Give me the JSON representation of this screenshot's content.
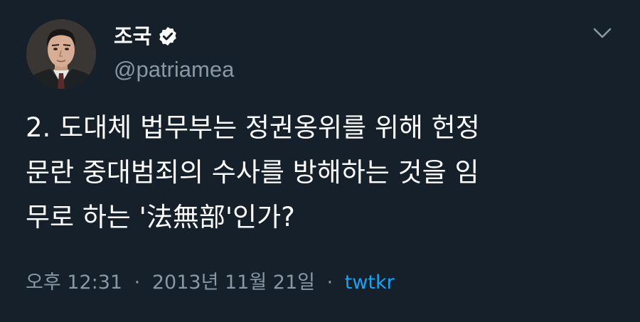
{
  "user": {
    "display_name": "조국",
    "handle": "@patriamea",
    "verified": true
  },
  "icons": {
    "verified": "verified-badge-icon",
    "menu": "chevron-down-icon"
  },
  "tweet": {
    "text": "2. 도대체 법무부는 정권옹위를 위해 헌정\n문란 중대범죄의 수사를 방해하는 것을 임\n무로 하는 '法無部'인가?"
  },
  "meta": {
    "time": "오후 12:31",
    "separator": "·",
    "date": "2013년 11월 21일",
    "source": "twtkr"
  },
  "colors": {
    "background": "#15202b",
    "text": "#ffffff",
    "secondary": "#8899a6",
    "link": "#1da1f2"
  }
}
